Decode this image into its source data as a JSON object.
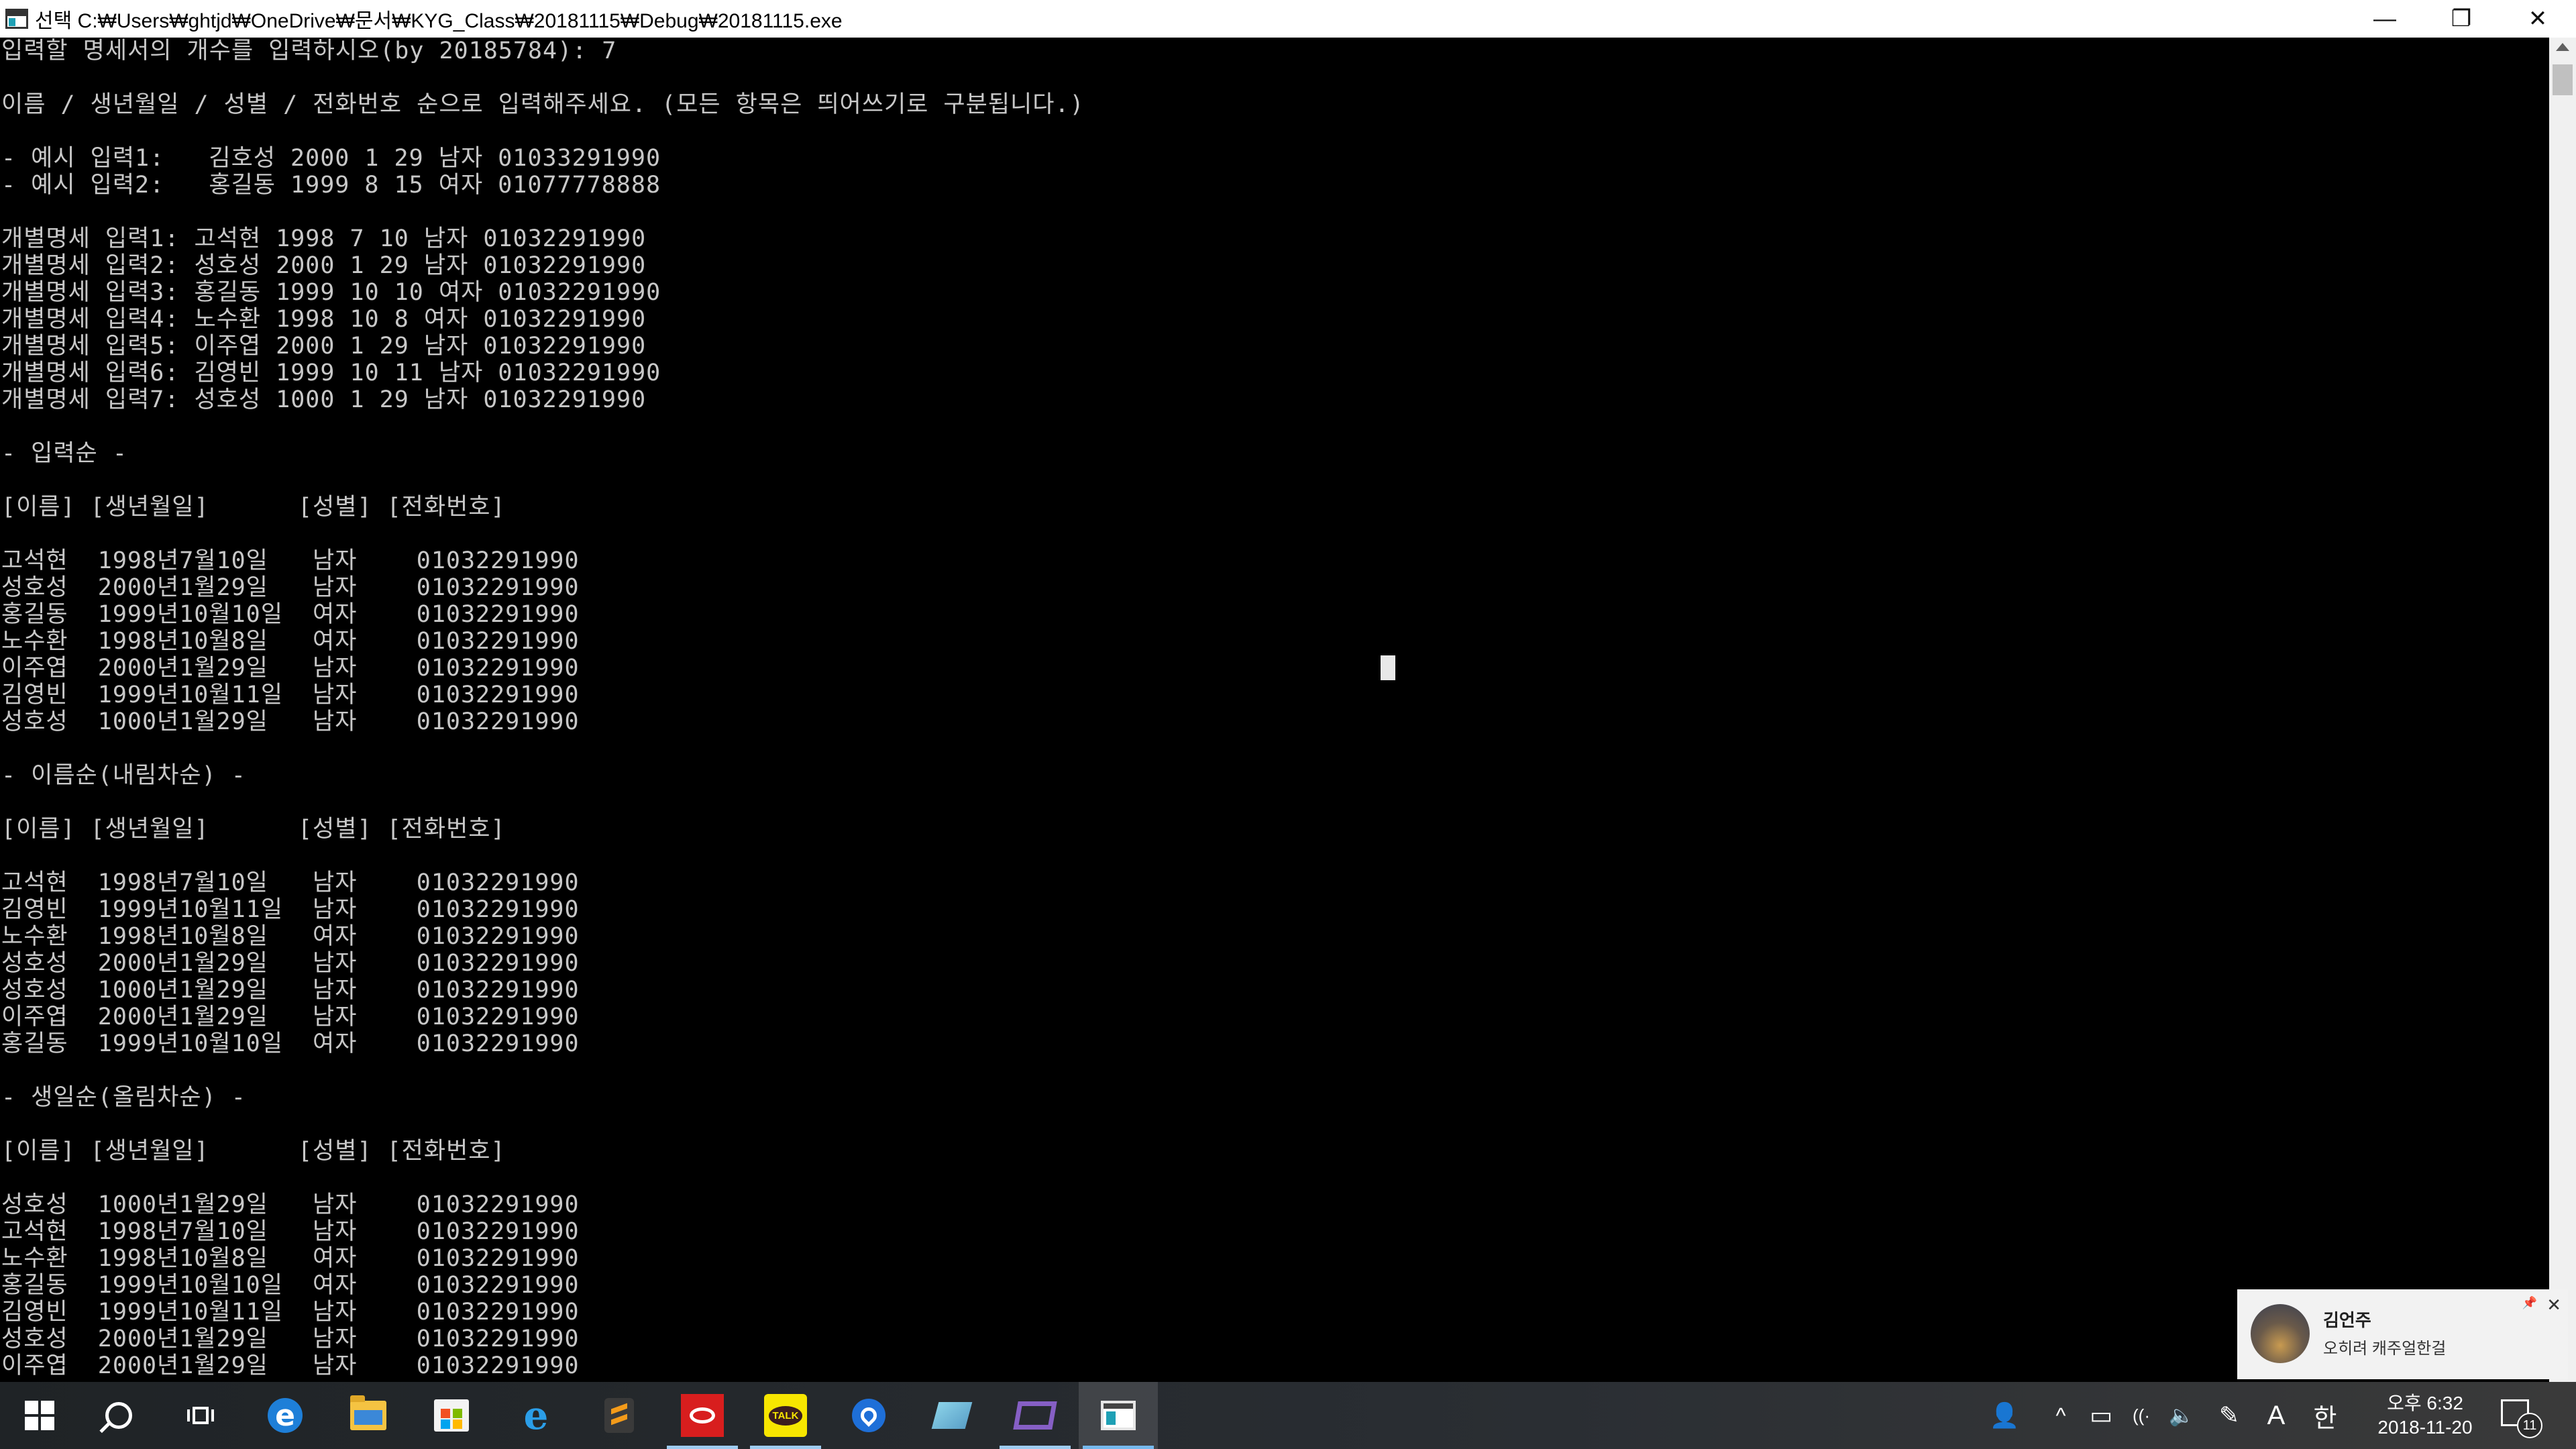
{
  "window": {
    "title": "선택 C:₩Users₩ghtjd₩OneDrive₩문서₩KYG_Class₩20181115₩Debug₩20181115.exe",
    "minimize_glyph": "—",
    "restore_glyph": "❐",
    "close_glyph": "✕"
  },
  "console": {
    "lines": [
      "입력할 명세서의 개수를 입력하시오(by 20185784): 7",
      "",
      "이름 / 생년월일 / 성별 / 전화번호 순으로 입력해주세요. (모든 항목은 띄어쓰기로 구분됩니다.)",
      "",
      "- 예시 입력1:   김호성 2000 1 29 남자 01033291990",
      "- 예시 입력2:   홍길동 1999 8 15 여자 01077778888",
      "",
      "개별명세 입력1: 고석현 1998 7 10 남자 01032291990",
      "개별명세 입력2: 성호성 2000 1 29 남자 01032291990",
      "개별명세 입력3: 홍길동 1999 10 10 여자 01032291990",
      "개별명세 입력4: 노수환 1998 10 8 여자 01032291990",
      "개별명세 입력5: 이주엽 2000 1 29 남자 01032291990",
      "개별명세 입력6: 김영빈 1999 10 11 남자 01032291990",
      "개별명세 입력7: 성호성 1000 1 29 남자 01032291990",
      "",
      "- 입력순 -",
      "",
      "[이름] [생년월일]      [성별] [전화번호]",
      "",
      "고석현  1998년7월10일   남자    01032291990",
      "성호성  2000년1월29일   남자    01032291990",
      "홍길동  1999년10월10일  여자    01032291990",
      "노수환  1998년10월8일   여자    01032291990",
      "이주엽  2000년1월29일   남자    01032291990",
      "김영빈  1999년10월11일  남자    01032291990",
      "성호성  1000년1월29일   남자    01032291990",
      "",
      "- 이름순(내림차순) -",
      "",
      "[이름] [생년월일]      [성별] [전화번호]",
      "",
      "고석현  1998년7월10일   남자    01032291990",
      "김영빈  1999년10월11일  남자    01032291990",
      "노수환  1998년10월8일   여자    01032291990",
      "성호성  2000년1월29일   남자    01032291990",
      "성호성  1000년1월29일   남자    01032291990",
      "이주엽  2000년1월29일   남자    01032291990",
      "홍길동  1999년10월10일  여자    01032291990",
      "",
      "- 생일순(올림차순) -",
      "",
      "[이름] [생년월일]      [성별] [전화번호]",
      "",
      "성호성  1000년1월29일   남자    01032291990",
      "고석현  1998년7월10일   남자    01032291990",
      "노수환  1998년10월8일   여자    01032291990",
      "홍길동  1999년10월10일  여자    01032291990",
      "김영빈  1999년10월11일  남자    01032291990",
      "성호성  2000년1월29일   남자    01032291990",
      "이주엽  2000년1월29일   남자    01032291990"
    ]
  },
  "notification": {
    "sender": "김언주",
    "message": "오히려 캐주얼한걸",
    "close_glyph": "✕",
    "pin_glyph": "📌"
  },
  "taskbar": {
    "items": [
      {
        "name": "start-button",
        "icon": "windows-icon"
      },
      {
        "name": "search-button",
        "icon": "search-icon"
      },
      {
        "name": "task-view-button",
        "icon": "task-view-icon"
      },
      {
        "name": "edge-button",
        "icon": "edge-icon",
        "glyph": "e"
      },
      {
        "name": "file-explorer-button",
        "icon": "folder-icon"
      },
      {
        "name": "store-button",
        "icon": "store-icon"
      },
      {
        "name": "internet-explorer-button",
        "icon": "ie-icon",
        "glyph": "e"
      },
      {
        "name": "sublime-text-button",
        "icon": "sublime-icon"
      },
      {
        "name": "creative-cloud-button",
        "icon": "creative-cloud-icon"
      },
      {
        "name": "kakaotalk-button",
        "icon": "kakaotalk-icon",
        "glyph": "TALK"
      },
      {
        "name": "maps-button",
        "icon": "maps-icon"
      },
      {
        "name": "eraser-app-button",
        "icon": "eraser-icon"
      },
      {
        "name": "visual-studio-button",
        "icon": "visual-studio-icon"
      },
      {
        "name": "console-app-button",
        "icon": "console-icon"
      }
    ],
    "tray": {
      "people_glyph": "👤",
      "chevron_glyph": "^",
      "battery_glyph": "▭",
      "wifi_glyph": "((·",
      "volume_glyph": "🔈",
      "pen_glyph": "✎",
      "ime_mode": "A",
      "ime_lang": "한"
    },
    "clock": {
      "time": "오후 6:32",
      "date": "2018-11-20"
    },
    "notifications_count": "11"
  },
  "colors": {
    "console_bg": "#000000",
    "console_fg": "#c8c8c8",
    "accent": "#76b9ed"
  }
}
